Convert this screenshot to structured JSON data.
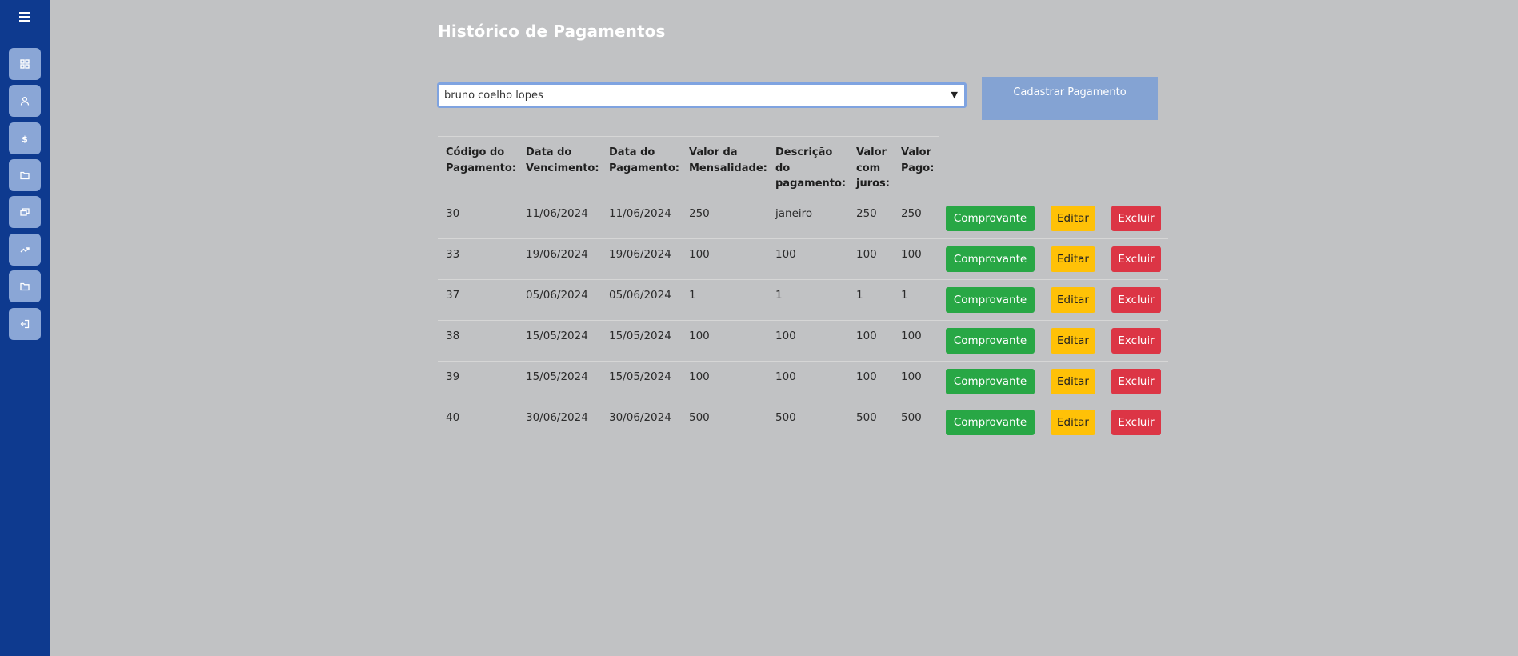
{
  "page": {
    "title": "Histórico de Pagamentos",
    "colors": {
      "sidebar": "#0e3a8f",
      "nav_button": "#8aa6d6",
      "background": "#c1c2c4",
      "primary_light": "#84a3d3",
      "success": "#28a745",
      "warning": "#ffc107",
      "danger": "#dc3545"
    }
  },
  "sidebar": {
    "menu_icon": "hamburger-icon",
    "items": [
      {
        "icon": "dashboard-grid-icon"
      },
      {
        "icon": "user-icon"
      },
      {
        "icon": "dollar-icon"
      },
      {
        "icon": "folder-icon"
      },
      {
        "icon": "cards-icon"
      },
      {
        "icon": "trend-chart-icon"
      },
      {
        "icon": "folder-icon"
      },
      {
        "icon": "logout-icon"
      }
    ]
  },
  "filter": {
    "selected_student": "bruno coelho lopes",
    "add_button_label": "Cadastrar Pagamento"
  },
  "table": {
    "headers": [
      "Código do\nPagamento:",
      "Data do\nVencimento:",
      "Data do\nPagamento:",
      "Valor da\nMensalidade:",
      "Descrição\ndo\npagamento:",
      "Valor\ncom\njuros:",
      "Valor\nPago:"
    ],
    "action_labels": {
      "receipt": "Comprovante",
      "edit": "Editar",
      "delete": "Excluir"
    },
    "rows": [
      {
        "codigo": "30",
        "vencimento": "11/06/2024",
        "pagamento": "11/06/2024",
        "mensalidade": "250",
        "descricao": "janeiro",
        "juros": "250",
        "pago": "250"
      },
      {
        "codigo": "33",
        "vencimento": "19/06/2024",
        "pagamento": "19/06/2024",
        "mensalidade": "100",
        "descricao": "100",
        "juros": "100",
        "pago": "100"
      },
      {
        "codigo": "37",
        "vencimento": "05/06/2024",
        "pagamento": "05/06/2024",
        "mensalidade": "1",
        "descricao": "1",
        "juros": "1",
        "pago": "1"
      },
      {
        "codigo": "38",
        "vencimento": "15/05/2024",
        "pagamento": "15/05/2024",
        "mensalidade": "100",
        "descricao": "100",
        "juros": "100",
        "pago": "100"
      },
      {
        "codigo": "39",
        "vencimento": "15/05/2024",
        "pagamento": "15/05/2024",
        "mensalidade": "100",
        "descricao": "100",
        "juros": "100",
        "pago": "100"
      },
      {
        "codigo": "40",
        "vencimento": "30/06/2024",
        "pagamento": "30/06/2024",
        "mensalidade": "500",
        "descricao": "500",
        "juros": "500",
        "pago": "500"
      }
    ]
  }
}
